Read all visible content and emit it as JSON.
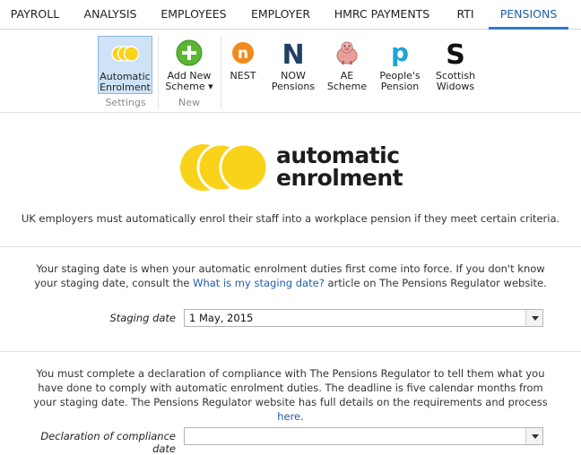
{
  "tabs": [
    {
      "label": "PAYROLL"
    },
    {
      "label": "ANALYSIS"
    },
    {
      "label": "EMPLOYEES"
    },
    {
      "label": "EMPLOYER"
    },
    {
      "label": "HMRC PAYMENTS"
    },
    {
      "label": "RTI"
    },
    {
      "label": "PENSIONS",
      "active": true
    }
  ],
  "ribbon": {
    "automatic_enrolment": {
      "line1": "Automatic",
      "line2": "Enrolment"
    },
    "add_new_scheme": {
      "line1": "Add New",
      "line2": "Scheme ▾"
    },
    "nest": {
      "line1": "NEST",
      "glyph": "n"
    },
    "now_pensions": {
      "line1": "NOW",
      "line2": "Pensions",
      "glyph": "N"
    },
    "ae_scheme": {
      "line1": "AE",
      "line2": "Scheme"
    },
    "peoples_pension": {
      "line1": "People's",
      "line2": "Pension",
      "glyph": "p"
    },
    "scottish_widows": {
      "line1": "Scottish",
      "line2": "Widows",
      "glyph": "S"
    },
    "groups": {
      "settings": "Settings",
      "new": "New"
    }
  },
  "logo": {
    "line1": "automatic",
    "line2": "enrolment",
    "color": "#f9d21a"
  },
  "intro": "UK employers must automatically enrol their staff into a workplace pension if they meet certain criteria.",
  "staging": {
    "text_before": "Your staging date is when your automatic enrolment duties first come into force. If you don't know your staging date, consult the ",
    "link": "What is my staging date?",
    "text_after": " article on The Pensions Regulator website.",
    "label": "Staging date",
    "value": "1 May, 2015"
  },
  "declaration": {
    "text_before": "You must complete a declaration of compliance with The Pensions Regulator to tell them what you have done to comply with automatic enrolment duties. The deadline is five calendar months from your staging date. The Pensions Regulator website has full details on the requirements and process ",
    "link": "here",
    "text_after": ".",
    "label": "Declaration of compliance date",
    "value": ""
  },
  "colors": {
    "accent": "#2e7bcf",
    "selected_bg": "#cfe3f6",
    "link": "#1e5fa8",
    "nest": "#f28a1e",
    "now": "#1f3f63",
    "people": "#1fa3d8",
    "add": "#5bb633"
  }
}
